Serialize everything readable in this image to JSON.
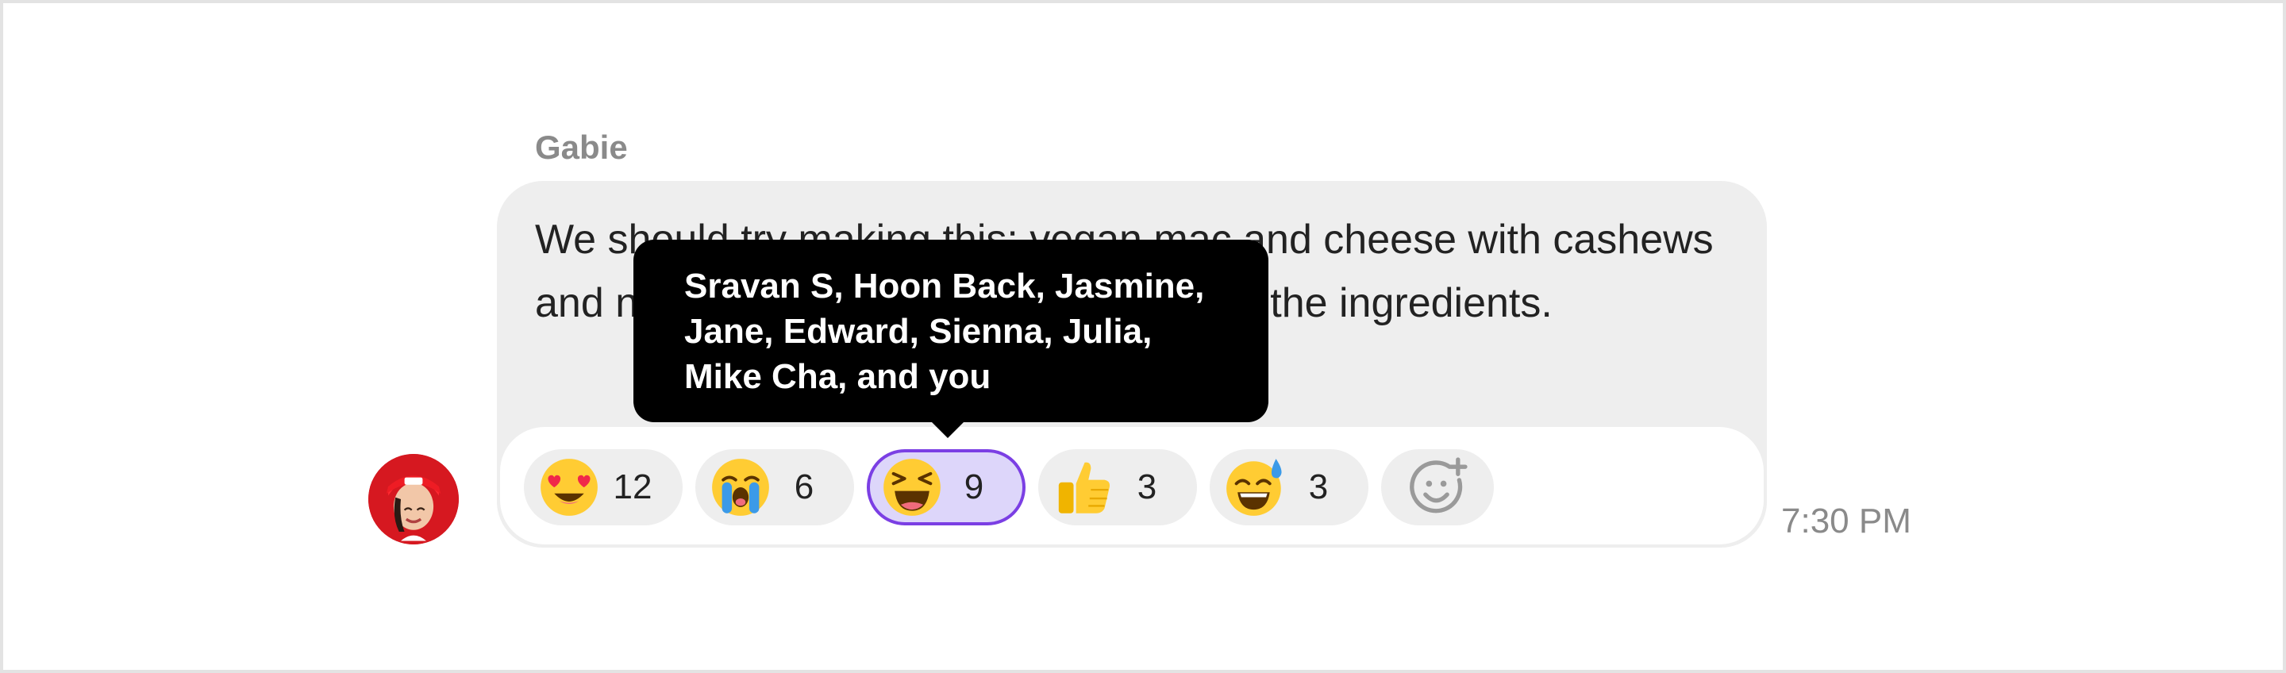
{
  "message": {
    "sender": "Gabie",
    "text": "We should try making this: vegan mac and cheese with cashews and nutritional yeast. I've already got all the ingredients.",
    "timestamp": "7:30 PM"
  },
  "reactions": [
    {
      "icon": "heart-eyes-emoji",
      "count": "12",
      "selected": false
    },
    {
      "icon": "crying-emoji",
      "count": "6",
      "selected": false
    },
    {
      "icon": "laughing-squint-emoji",
      "count": "9",
      "selected": true
    },
    {
      "icon": "thumbs-up-emoji",
      "count": "3",
      "selected": false
    },
    {
      "icon": "sweat-smile-emoji",
      "count": "3",
      "selected": false
    }
  ],
  "add_reaction": {
    "icon": "add-reaction-icon"
  },
  "tooltip": {
    "text": "Sravan S, Hoon Back, Jasmine, Jane, Edward, Sienna, Julia, Mike Cha, and you"
  },
  "colors": {
    "bubble": "#eeeeee",
    "selected_chip_bg": "#ddd6fa",
    "selected_chip_border": "#7b3fe4",
    "tooltip_bg": "#000000",
    "emoji_yellow": "#ffcc33",
    "avatar_red": "#e31b23"
  }
}
